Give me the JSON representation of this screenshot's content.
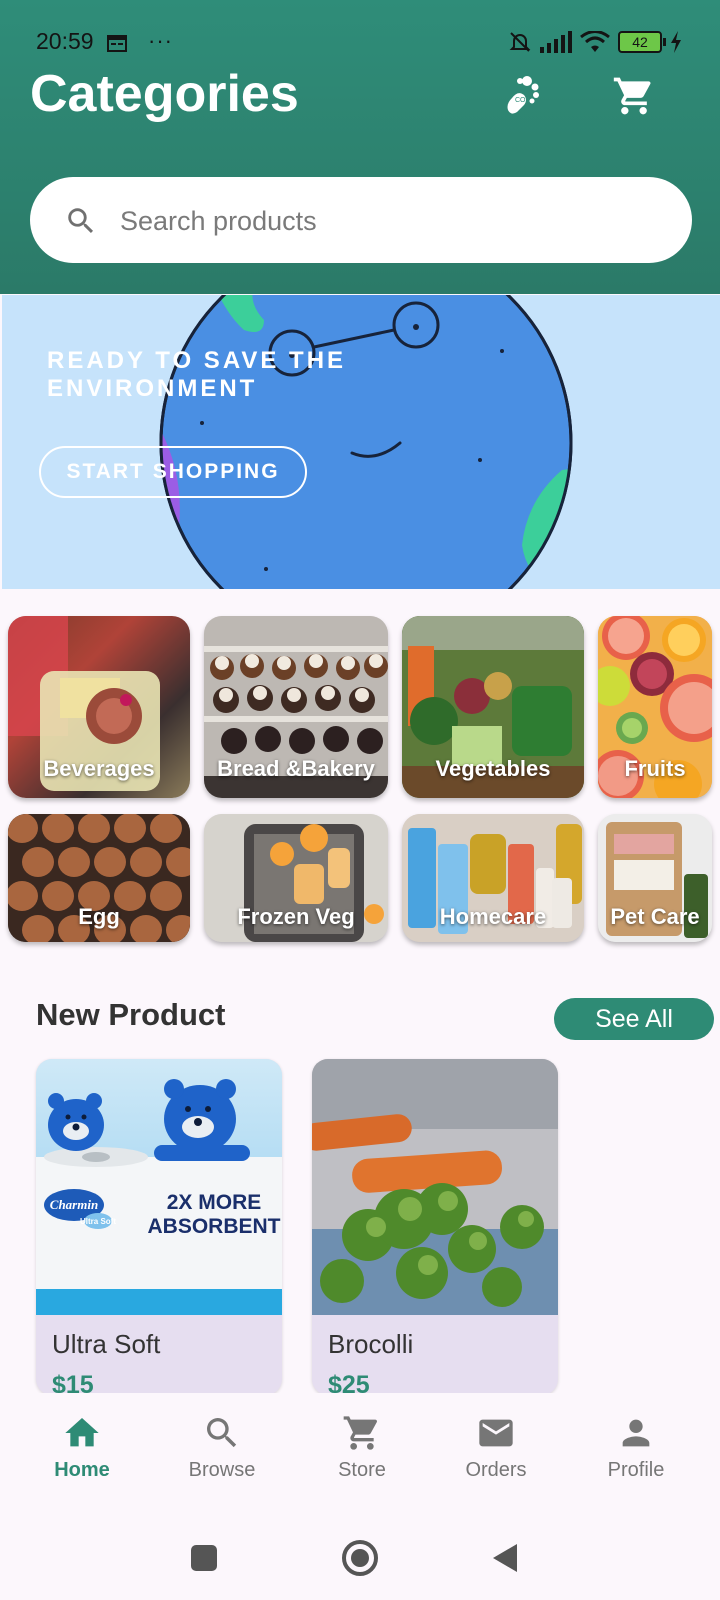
{
  "status_bar": {
    "time": "20:59",
    "more": "···",
    "battery": "42"
  },
  "header": {
    "title": "Categories",
    "icons": [
      "co2-footprint-icon",
      "cart-icon"
    ]
  },
  "search": {
    "placeholder": "Search products",
    "value": ""
  },
  "banner": {
    "headline": "READY TO SAVE THE ENVIRONMENT",
    "button": "START SHOPPING"
  },
  "categories": [
    {
      "label": "Beverages",
      "icon": "beverages-image"
    },
    {
      "label": "Bread &Bakery",
      "icon": "bakery-image"
    },
    {
      "label": "Vegetables",
      "icon": "vegetables-image"
    },
    {
      "label": "Fruits",
      "icon": "fruits-image"
    },
    {
      "label": "Egg",
      "icon": "egg-image"
    },
    {
      "label": "Frozen Veg",
      "icon": "frozen-veg-image"
    },
    {
      "label": "Homecare",
      "icon": "homecare-image"
    },
    {
      "label": "Pet Care",
      "icon": "pet-care-image"
    }
  ],
  "new_product": {
    "title": "New Product",
    "see_all": "See All",
    "items": [
      {
        "name": "Ultra Soft",
        "price": "$15",
        "image_text": {
          "brand": "Charmin",
          "sub": "Ultra Soft",
          "line1": "2X MORE",
          "line2": "ABSORBENT"
        }
      },
      {
        "name": "Brocolli",
        "price": "$25"
      }
    ]
  },
  "bottom_nav": {
    "items": [
      {
        "label": "Home",
        "icon": "home-icon",
        "active": true
      },
      {
        "label": "Browse",
        "icon": "search-icon",
        "active": false
      },
      {
        "label": "Store",
        "icon": "cart-icon",
        "active": false
      },
      {
        "label": "Orders",
        "icon": "mail-icon",
        "active": false
      },
      {
        "label": "Profile",
        "icon": "person-icon",
        "active": false
      }
    ]
  },
  "colors": {
    "brand": "#2e8b75",
    "header": "#2f8d79",
    "banner_bg": "#c6e3fb",
    "background": "#fcf7fc"
  }
}
